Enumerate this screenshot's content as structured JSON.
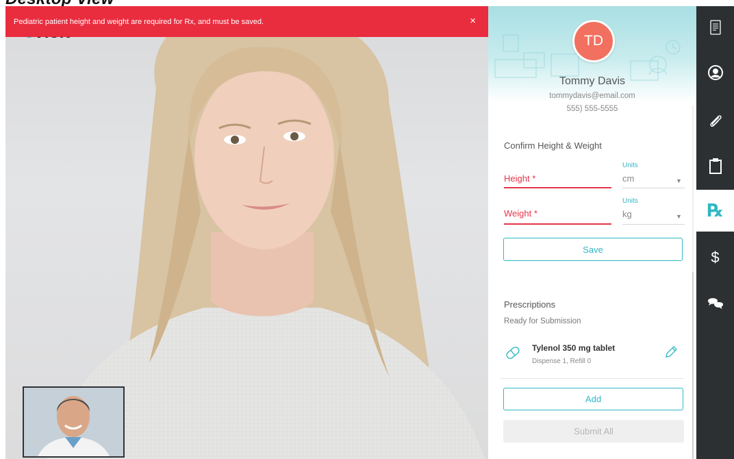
{
  "page": {
    "heading": "Desktop View"
  },
  "alert": {
    "message": "Pediatric patient height and weight are required for Rx, and must be saved.",
    "close_glyph": "×",
    "color": "#ea2c3f"
  },
  "logo": {
    "prefix": "e",
    "text": "visit"
  },
  "patient": {
    "initials": "TD",
    "name": "Tommy Davis",
    "email": "tommydavis@email.com",
    "phone": "555) 555-5555",
    "avatar_color": "#f2705f"
  },
  "vitals": {
    "section_title": "Confirm Height & Weight",
    "height": {
      "label": "Height *",
      "units_caption": "Units",
      "unit": "cm"
    },
    "weight": {
      "label": "Weight *",
      "units_caption": "Units",
      "unit": "kg"
    },
    "save_label": "Save"
  },
  "prescriptions": {
    "title": "Prescriptions",
    "status": "Ready for Submission",
    "items": [
      {
        "name": "Tylenol 350 mg tablet",
        "detail": "Dispense 1, Refill 0",
        "icon": "pill-icon",
        "action_icon": "pencil-icon"
      }
    ],
    "add_label": "Add",
    "submit_label": "Submit All"
  },
  "sidebar": {
    "items": [
      {
        "icon": "document-icon",
        "active": false
      },
      {
        "icon": "user-circle-icon",
        "active": false
      },
      {
        "icon": "paperclip-icon",
        "active": false
      },
      {
        "icon": "clipboard-icon",
        "active": false
      },
      {
        "icon": "rx-icon",
        "label": "℞",
        "active": true
      },
      {
        "icon": "dollar-icon",
        "label": "$",
        "active": false
      },
      {
        "icon": "chat-bubbles-icon",
        "active": false
      }
    ]
  },
  "colors": {
    "accent": "#2fb7c4",
    "error": "#e6364a",
    "rail": "#2d3033"
  }
}
